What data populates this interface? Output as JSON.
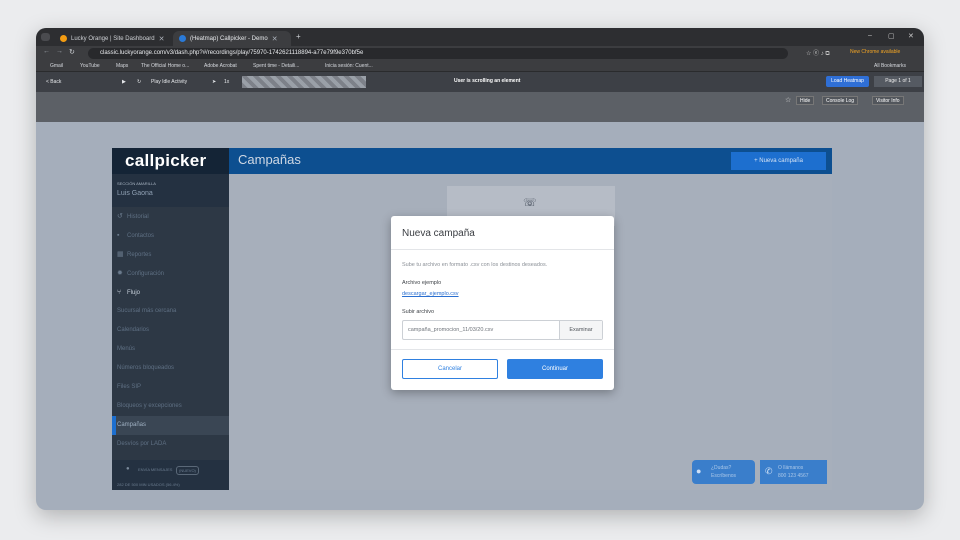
{
  "browser": {
    "tabs": [
      {
        "label": "Lucky Orange | Site Dashboard"
      },
      {
        "label": "(Heatmap) Callpicker - Demo"
      }
    ],
    "new_tab": "+",
    "url": "classic.luckyorange.com/v3/dash.php?#/recordings/play/75970-1742621118894-a77e79f9e370bf5e",
    "new_chrome": "New Chrome available",
    "bookmarks": [
      "Gmail",
      "YouTube",
      "Maps",
      "The Official Home o...",
      "Adobe Acrobat",
      "Spent time - Detaili...",
      "Inicia sesión: Cuent..."
    ],
    "all_bookmarks": "All Bookmarks"
  },
  "player": {
    "back": "< Back",
    "play_idle": "Play Idle Activity",
    "speed": "1x",
    "status": "User is scrolling an element",
    "load_heatmap": "Load Heatmap",
    "page": "Page 1 of 1",
    "hide": "Hide",
    "console": "Console Log",
    "visitor": "Visitor Info"
  },
  "app": {
    "logo": "callpicker",
    "page_title": "Campañas",
    "new_campaign": "+ Nueva campaña",
    "user_section": "SECCIÓN AMARILLA",
    "user_name": "Luis Gaona",
    "nav": [
      {
        "label": "Historial",
        "icon": "history-icon"
      },
      {
        "label": "Contactos",
        "icon": "contacts-icon"
      },
      {
        "label": "Reportes",
        "icon": "chart-icon"
      },
      {
        "label": "Configuración",
        "icon": "gear-icon"
      },
      {
        "label": "Flujo",
        "icon": "flow-icon"
      },
      {
        "label": "Sucursal más cercana"
      },
      {
        "label": "Calendarios"
      },
      {
        "label": "Menús"
      },
      {
        "label": "Números bloqueados"
      },
      {
        "label": "Files SIP"
      },
      {
        "label": "Bloqueos y excepciones"
      },
      {
        "label": "Campañas"
      },
      {
        "label": "Desvíos por LADA"
      }
    ],
    "footer_line1": "ENVÍA MENSAJES",
    "footer_badge": "(NUEVO)",
    "footer_line2": "282 DE 500 MIN USADOS (56.4%)",
    "help_text": "¿Dudas?",
    "help_sub": "Escríbenos",
    "call_text": "O llámanos",
    "call_sub": "800 123 4567"
  },
  "modal": {
    "title": "Nueva campaña",
    "hint": "Sube tu archivo en formato .csv con los destinos deseados.",
    "example_label": "Archivo ejemplo",
    "example_link": "descargar_ejemplo.csv",
    "upload_label": "Subir archivo",
    "file_value": "campaña_promocion_11/03/20.csv",
    "browse": "Examinar",
    "cancel": "Cancelar",
    "continue": "Continuar"
  }
}
